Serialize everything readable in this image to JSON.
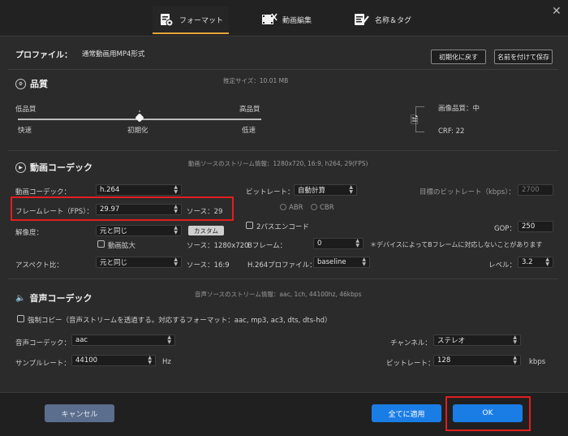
{
  "tabs": [
    {
      "label": "フォーマット",
      "icon": "format-settings-icon"
    },
    {
      "label": "動画編集",
      "icon": "video-edit-icon"
    },
    {
      "label": "名称＆タグ",
      "icon": "tag-edit-icon"
    }
  ],
  "profile": {
    "label": "プロファイル：",
    "value": "通常動画用MP4形式",
    "reset_label": "初期化に戻す",
    "save_label": "名前を付けて保存"
  },
  "quality": {
    "title": "品質",
    "estimated_size": "推定サイズ：10.01 MB",
    "low": "低品質",
    "high": "高品質",
    "fast": "快速",
    "default": "初期化",
    "slow": "低速",
    "slider_fraction": 0.5,
    "image_quality": "画像品質：中",
    "crf": "CRF: 22"
  },
  "video": {
    "title": "動画コーデック",
    "stream_info": "動画ソースのストリーム情報：1280x720, 16:9, h264, 29(FPS)",
    "codec_label": "動画コーデック：",
    "codec_value": "h.264",
    "fps_label": "フレームレート（FPS）：",
    "fps_value": "29.97",
    "fps_source": "ソース：29",
    "resolution_label": "解像度：",
    "resolution_value": "元と同じ",
    "custom_label": "カスタム",
    "upscale_label": "動画拡大",
    "resolution_source": "ソース：1280x720",
    "aspect_label": "アスペクト比：",
    "aspect_value": "元と同じ",
    "aspect_source": "ソース：16:9",
    "bitrate_label": "ビットレート：",
    "bitrate_value": "自動計算",
    "abr": "ABR",
    "cbr": "CBR",
    "target_bitrate_label": "目標のビットレート（kbps）：",
    "target_bitrate_value": "2700",
    "twopass_label": "2パスエンコード",
    "gop_label": "GOP：",
    "gop_value": "250",
    "bframe_label": "Bフレーム：",
    "bframe_value": "0",
    "bframe_note": "＊デバイスによってBフレームに対応しないことがあります",
    "profile_label": "H.264プロファイル：",
    "profile_value": "baseline",
    "level_label": "レベル：",
    "level_value": "3.2"
  },
  "audio": {
    "title": "音声コーデック",
    "stream_info": "音声ソースのストリーム情報：aac, 1ch, 44100hz, 46kbps",
    "force_copy_label": "強制コピー（音声ストリームを透過する。対応するフォーマット：aac, mp3, ac3, dts, dts-hd）",
    "codec_label": "音声コーデック：",
    "codec_value": "aac",
    "sample_label": "サンプルレート：",
    "sample_value": "44100",
    "hz": "Hz",
    "channel_label": "チャンネル：",
    "channel_value": "ステレオ",
    "bitrate_label": "ビットレート：",
    "bitrate_value": "128",
    "kbps": "kbps"
  },
  "footer": {
    "cancel_label": "キャンセル",
    "apply_all_label": "全てに適用",
    "ok_label": "OK"
  },
  "colors": {
    "accent_blue": "#1a7de6",
    "highlight_red": "#e31e1e",
    "tab_underline": "#e3a43a"
  }
}
